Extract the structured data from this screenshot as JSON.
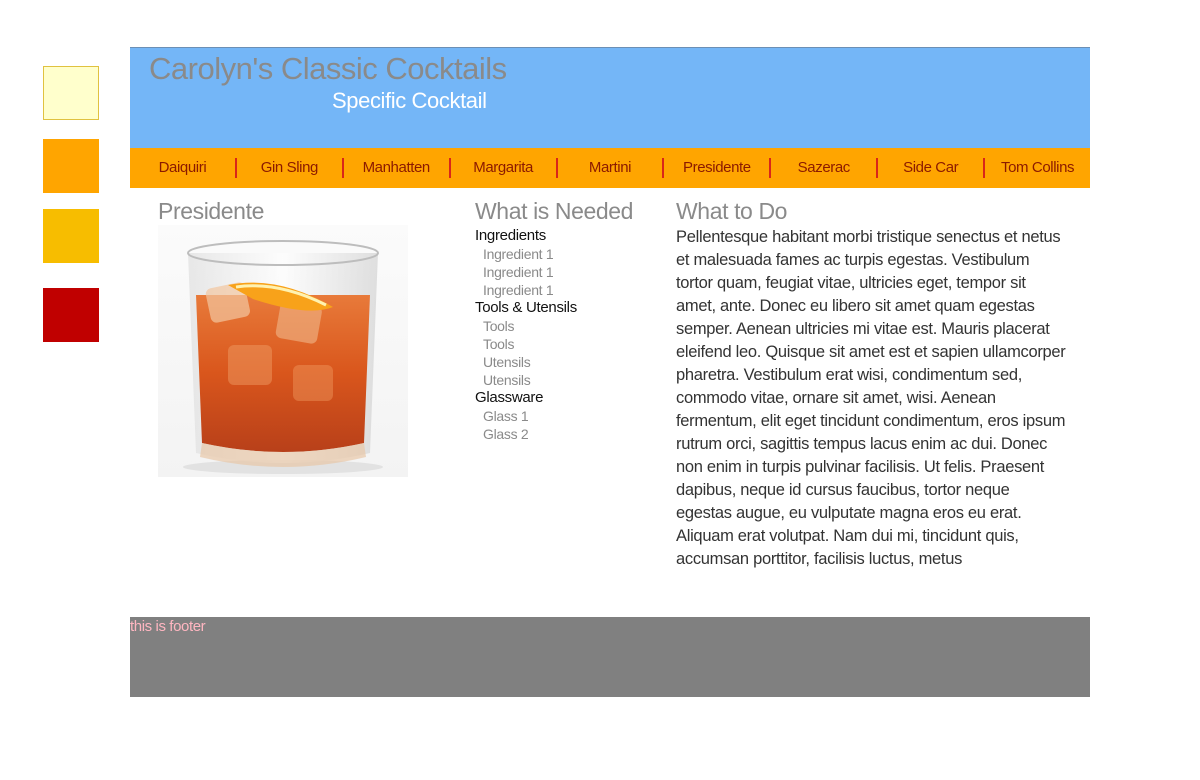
{
  "swatches": [
    {
      "name": "swatch-pale-yellow",
      "color": "#ffffcc",
      "border": "#e0c240"
    },
    {
      "name": "swatch-orange",
      "color": "#ffa500"
    },
    {
      "name": "swatch-gold",
      "color": "#f7bd00"
    },
    {
      "name": "swatch-red",
      "color": "#c00000"
    }
  ],
  "header": {
    "title": "Carolyn's Classic Cocktails",
    "subtitle": "Specific Cocktail"
  },
  "nav": {
    "items": [
      "Daiquiri",
      "Gin Sling",
      "Manhatten",
      "Margarita",
      "Martini",
      "Presidente",
      "Sazerac",
      "Side Car",
      "Tom Collins"
    ]
  },
  "main": {
    "cocktail_title": "Presidente",
    "photo_icon": "cocktail-glass-photo",
    "needed_title": "What is Needed",
    "ingredients_head": "Ingredients",
    "ingredients": [
      "Ingredient 1",
      "Ingredient 1",
      "Ingredient 1"
    ],
    "tools_head": "Tools & Utensils",
    "tools": [
      "Tools",
      "Tools",
      "Utensils",
      "Utensils"
    ],
    "glassware_head": "Glassware",
    "glassware": [
      "Glass 1",
      "Glass 2"
    ],
    "todo_title": "What to Do",
    "todo_text": "Pellentesque habitant morbi tristique senectus et netus et malesuada fames ac turpis egestas. Vestibulum tortor quam, feugiat vitae, ultricies eget, tempor sit amet, ante. Donec eu libero sit amet quam egestas semper. Aenean ultricies mi vitae est. Mauris placerat eleifend leo. Quisque sit amet est et sapien ullamcorper pharetra. Vestibulum erat wisi, condimentum sed, commodo vitae, ornare sit amet, wisi. Aenean fermentum, elit eget tincidunt condimentum, eros ipsum rutrum orci, sagittis tempus lacus enim ac dui. Donec non enim in turpis pulvinar facilisis. Ut felis. Praesent dapibus, neque id cursus faucibus, tortor neque egestas augue, eu vulputate magna eros eu erat. Aliquam erat volutpat. Nam dui mi, tincidunt quis, accumsan porttitor, facilisis luctus, metus"
  },
  "footer": {
    "text": "this is footer"
  }
}
